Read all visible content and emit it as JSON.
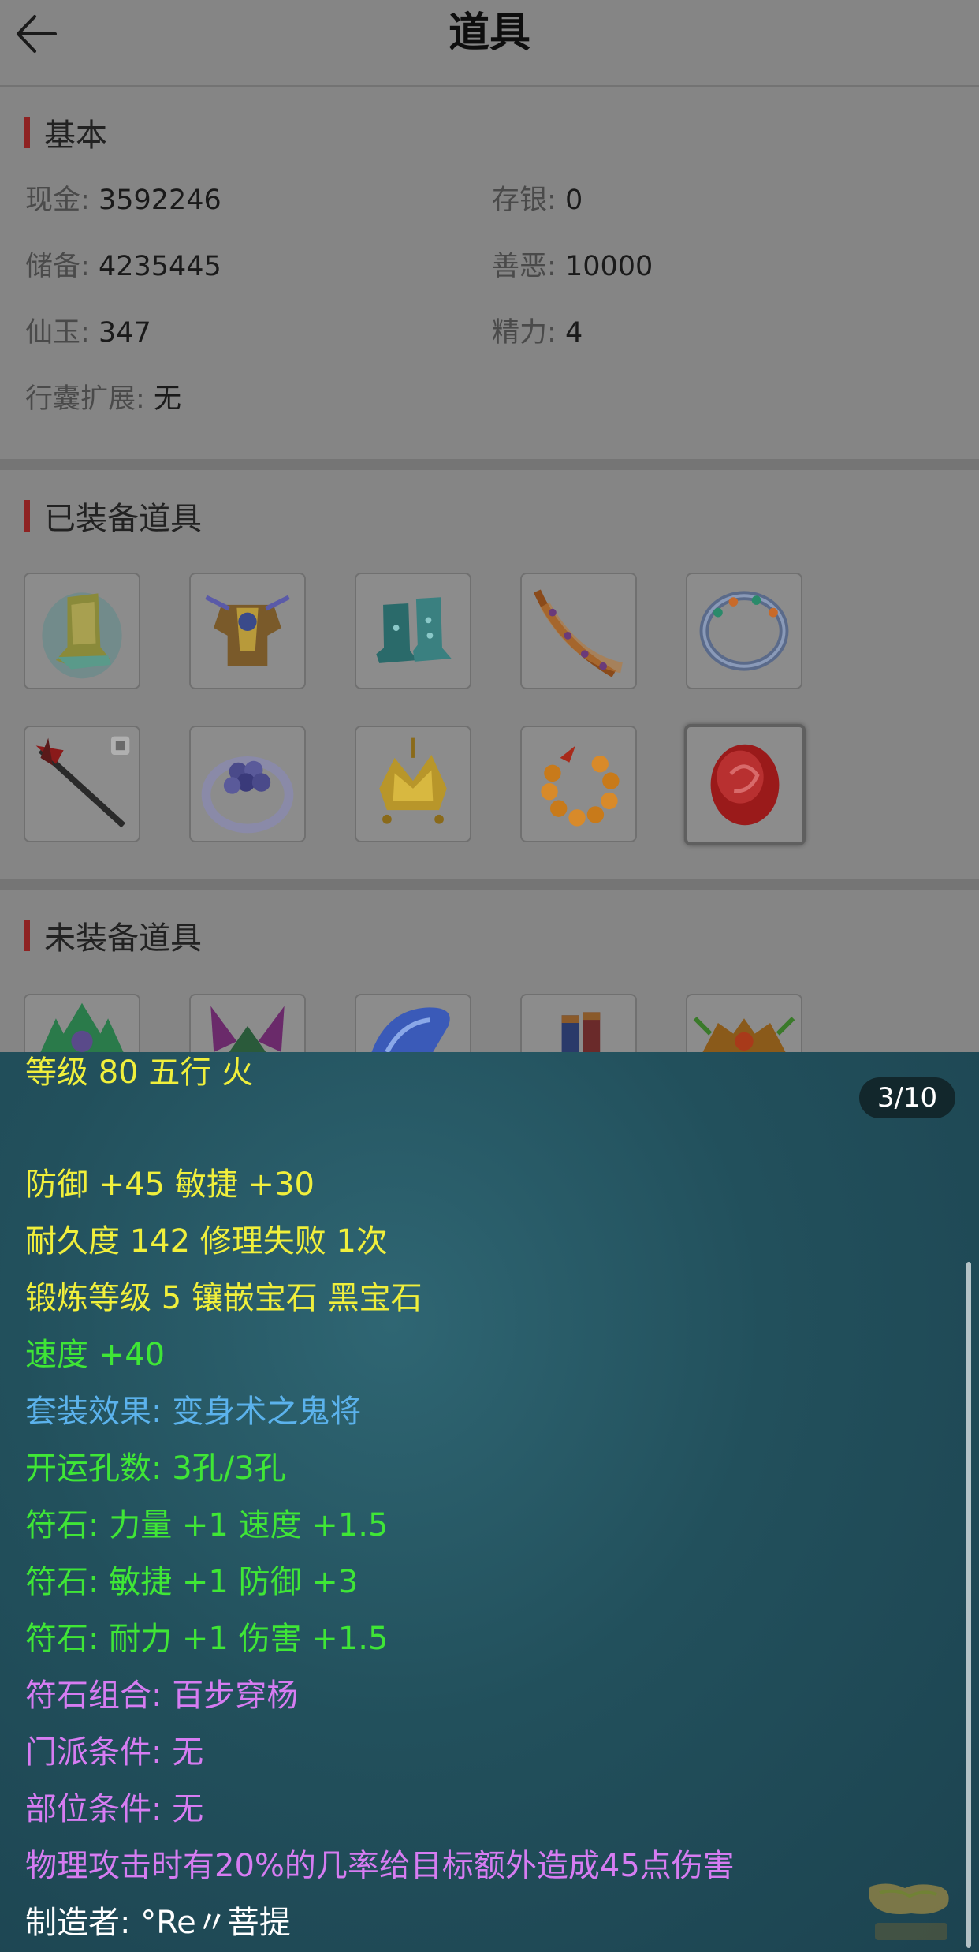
{
  "header": {
    "title": "道具"
  },
  "basic": {
    "title": "基本",
    "rows": [
      {
        "label": "现金:",
        "value": "3592246"
      },
      {
        "label": "存银:",
        "value": "0"
      },
      {
        "label": "储备:",
        "value": "4235445"
      },
      {
        "label": "善恶:",
        "value": "10000"
      },
      {
        "label": "仙玉:",
        "value": "347"
      },
      {
        "label": "精力:",
        "value": "4"
      },
      {
        "label": "行囊扩展:",
        "value": "无"
      }
    ]
  },
  "equipped": {
    "title": "已装备道具",
    "items": [
      "boot-item",
      "armor-item",
      "boots-item",
      "belt-item",
      "bracelet-item",
      "spear-weapon-item",
      "ring-item",
      "crown-item",
      "beads-necklace-item",
      "red-gem-item"
    ],
    "selected_index": 9
  },
  "unequipped": {
    "title": "未装备道具"
  },
  "detail": {
    "page": "3/10",
    "lines": [
      {
        "text": "等级 80 五行 火",
        "color": "yellow"
      },
      {
        "text": "防御 +45 敏捷 +30",
        "color": "yellow"
      },
      {
        "text": "耐久度 142 修理失败 1次",
        "color": "yellow"
      },
      {
        "text": "锻炼等级 5 镶嵌宝石 黑宝石",
        "color": "yellow"
      },
      {
        "text": "速度 +40",
        "color": "green"
      },
      {
        "text": "套装效果: 变身术之鬼将",
        "color": "blue"
      },
      {
        "text": "开运孔数: 3孔/3孔",
        "color": "green"
      },
      {
        "text": "符石: 力量 +1 速度 +1.5",
        "color": "green"
      },
      {
        "text": "符石: 敏捷 +1 防御 +3",
        "color": "green"
      },
      {
        "text": "符石: 耐力 +1 伤害 +1.5",
        "color": "green"
      },
      {
        "text": "符石组合: 百步穿杨",
        "color": "purple"
      },
      {
        "text": "门派条件: 无",
        "color": "purple"
      },
      {
        "text": "部位条件: 无",
        "color": "purple"
      },
      {
        "text": "物理攻击时有20%的几率给目标额外造成45点伤害",
        "color": "purple"
      },
      {
        "text": "制造者: °Re〃菩提",
        "color": "white"
      }
    ]
  },
  "colors": {
    "yellow": "#f0ef3c",
    "green": "#3fe636",
    "blue": "#5bb2ec",
    "purple": "#d67cf2",
    "section_bar": "#8e2222"
  }
}
